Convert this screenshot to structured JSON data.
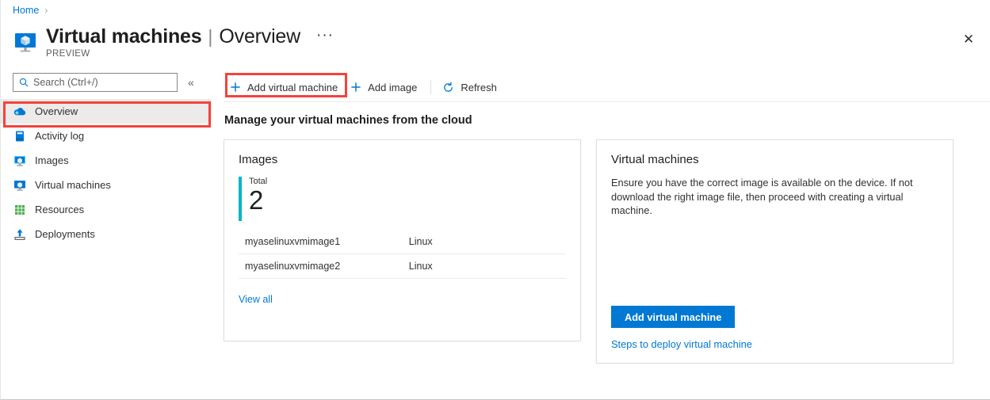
{
  "breadcrumb": {
    "home": "Home",
    "separator": "›"
  },
  "header": {
    "title": "Virtual machines",
    "divider": "|",
    "subtitle": "Overview",
    "ellipsis": "···",
    "preview": "PREVIEW",
    "close_label": "✕",
    "icon": "virtual-machine-icon"
  },
  "sidebar": {
    "search": {
      "placeholder": "Search (Ctrl+/)",
      "value": "",
      "icon": "search-icon"
    },
    "collapse": {
      "label": "«",
      "icon": "chevron-double-left-icon"
    },
    "items": [
      {
        "label": "Overview",
        "icon": "cloud-icon",
        "selected": true
      },
      {
        "label": "Activity log",
        "icon": "activity-log-icon",
        "selected": false
      },
      {
        "label": "Images",
        "icon": "images-icon",
        "selected": false
      },
      {
        "label": "Virtual machines",
        "icon": "virtual-machine-icon",
        "selected": false
      },
      {
        "label": "Resources",
        "icon": "resources-grid-icon",
        "selected": false
      },
      {
        "label": "Deployments",
        "icon": "deployments-icon",
        "selected": false
      }
    ]
  },
  "toolbar": {
    "add_vm": {
      "label": "Add virtual machine",
      "icon": "plus-icon"
    },
    "add_image": {
      "label": "Add image",
      "icon": "plus-icon"
    },
    "refresh": {
      "label": "Refresh",
      "icon": "refresh-icon"
    }
  },
  "main": {
    "heading": "Manage your virtual machines from the cloud",
    "images_card": {
      "title": "Images",
      "metric_label": "Total",
      "metric_value": "2",
      "accent_color": "#00b7c3",
      "rows": [
        {
          "name": "myaselinuxvmimage1",
          "os": "Linux"
        },
        {
          "name": "myaselinuxvmimage2",
          "os": "Linux"
        }
      ],
      "view_all": "View all"
    },
    "vm_card": {
      "title": "Virtual machines",
      "description": "Ensure you have the correct image is available on the device. If not download the right image file, then proceed with creating a virtual machine.",
      "primary_button": "Add virtual machine",
      "secondary_link": "Steps to deploy virtual machine",
      "button_color": "#0078d4"
    }
  },
  "annotations": {
    "highlight_color": "#f4433c",
    "boxes": [
      {
        "name": "add-virtual-machine-highlight"
      },
      {
        "name": "overview-nav-highlight"
      }
    ]
  }
}
